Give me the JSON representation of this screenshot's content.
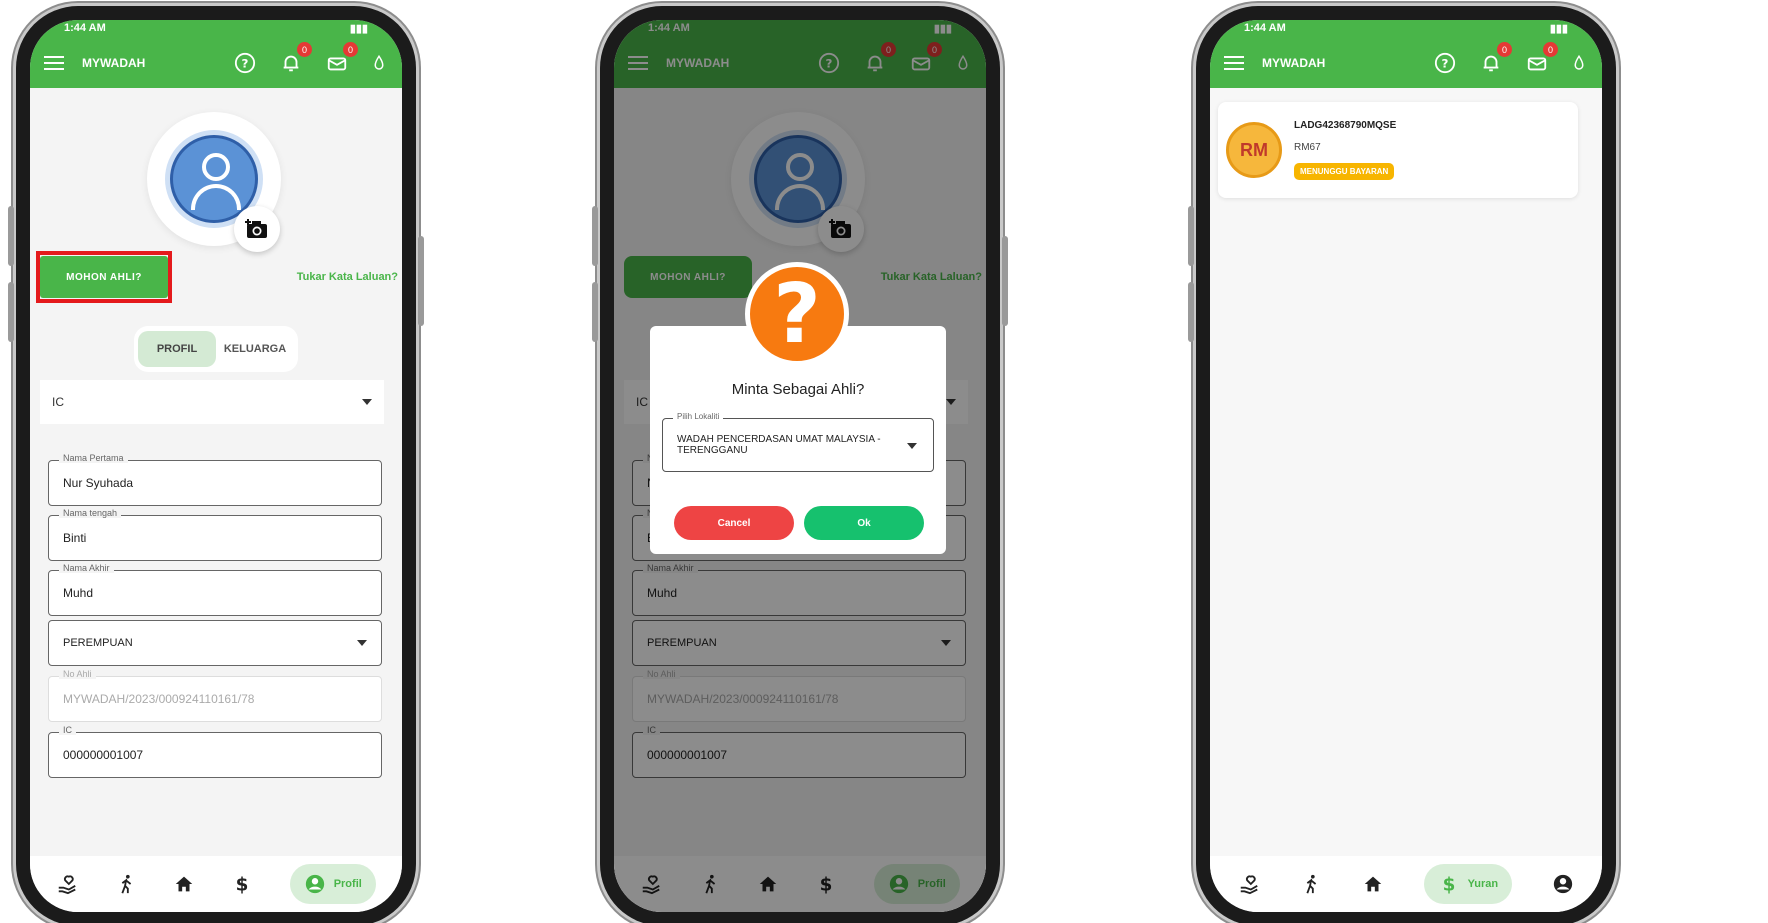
{
  "app": {
    "title": "MYWADAH",
    "status_time": "1:44 AM",
    "notif_count": "0",
    "mail_count": "0"
  },
  "profile": {
    "mohon_label": "MOHON AHLI?",
    "tukar_label": "Tukar Kata Laluan?",
    "tabs": [
      "PROFIL",
      "KELUARGA"
    ],
    "id_type": "IC",
    "fields": [
      {
        "label": "Nama Pertama",
        "value": "Nur Syuhada"
      },
      {
        "label": "Nama tengah",
        "value": "Binti"
      },
      {
        "label": "Nama Akhir",
        "value": "Muhd"
      }
    ],
    "gender": "PEREMPUAN",
    "no_ahli_label": "No Ahli",
    "no_ahli_value": "MYWADAH/2023/000924110161/78",
    "ic_label": "IC",
    "ic_value": "000000001007"
  },
  "dialog": {
    "title": "Minta Sebagai Ahli?",
    "select_label": "Pilih Lokaliti",
    "select_value": "WADAH PENCERDASAN UMAT MALAYSIA - TERENGGANU",
    "cancel_label": "Cancel",
    "ok_label": "Ok"
  },
  "yuran": {
    "coin_text": "RM",
    "code": "LADG42368790MQSE",
    "amount": "RM67",
    "status": "MENUNGGU BAYARAN"
  },
  "nav": {
    "profil_label": "Profil",
    "yuran_label": "Yuran"
  },
  "colors": {
    "primary": "#49b549",
    "badge": "#e53935",
    "highlight": "#e41a1c",
    "question": "#f77a10",
    "cancel": "#ee4444",
    "ok": "#16c16e",
    "pending": "#f7b500"
  }
}
